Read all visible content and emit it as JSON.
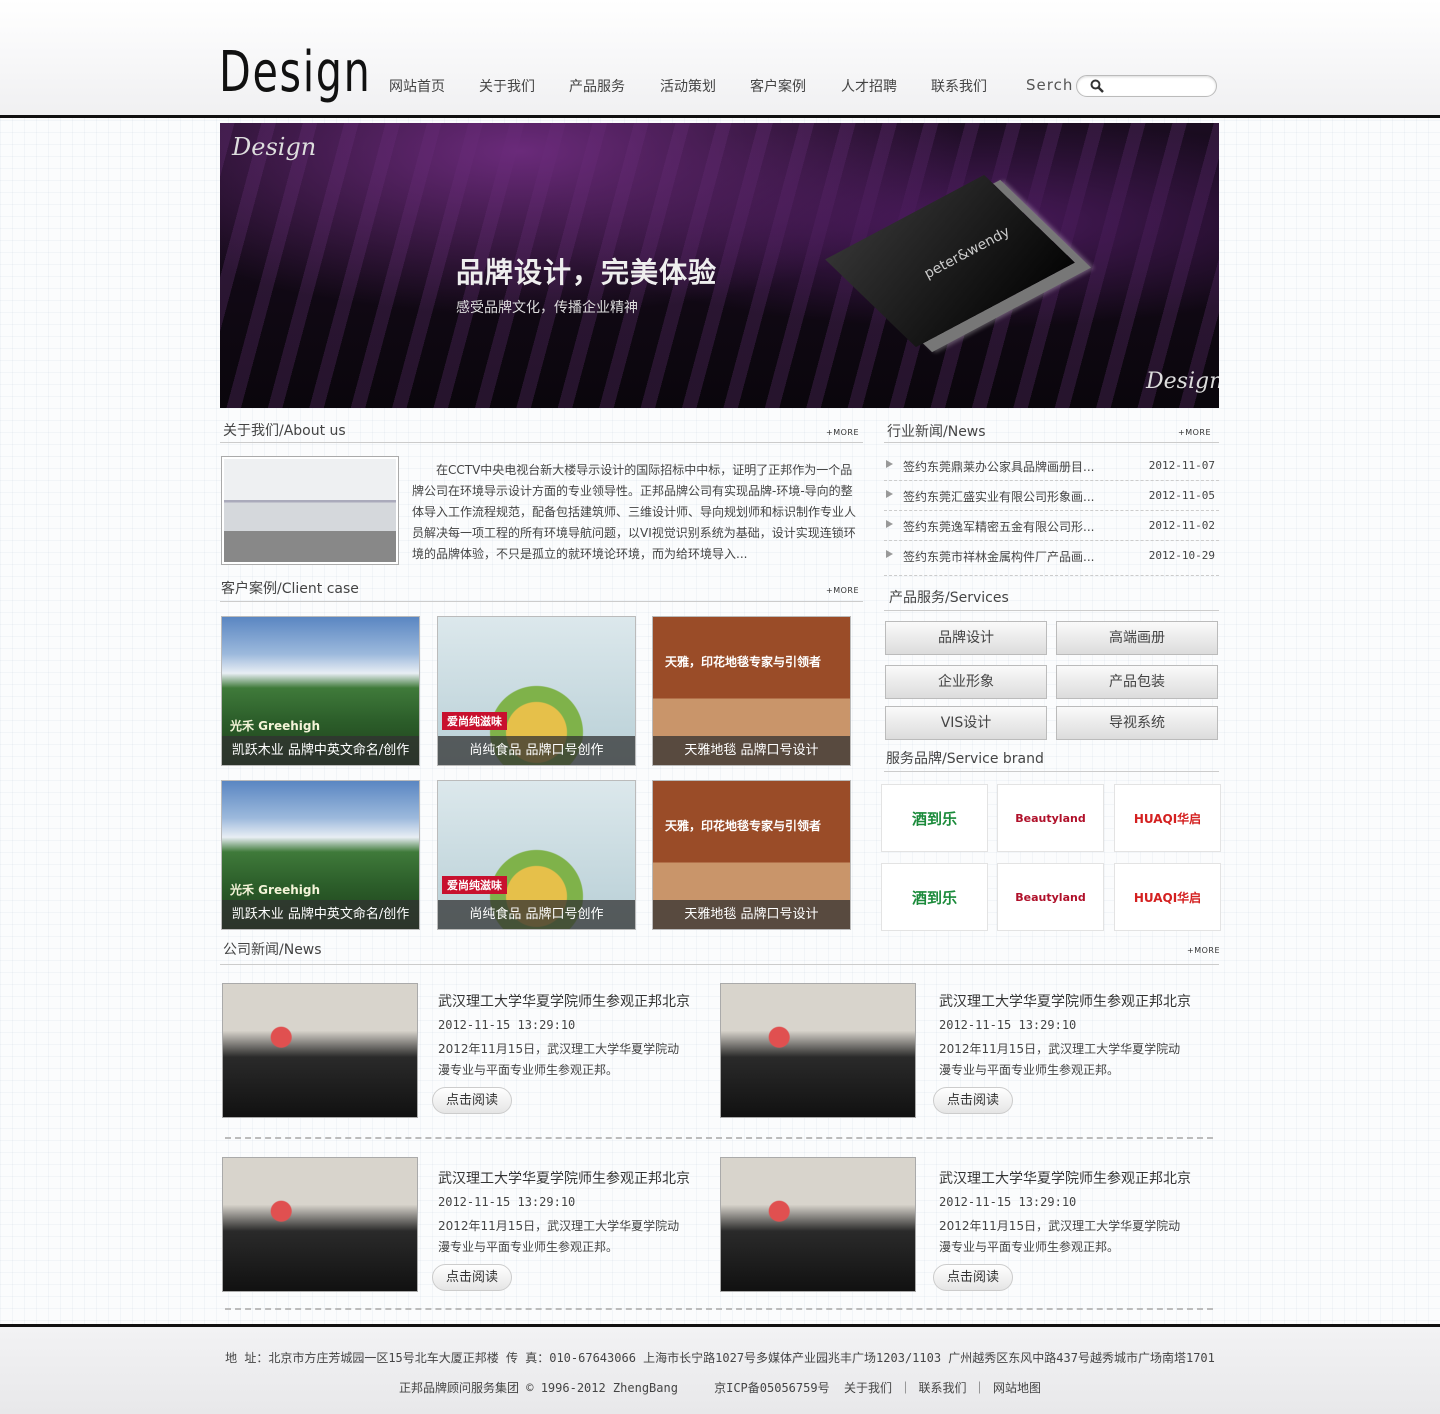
{
  "header": {
    "logo": "Design",
    "nav": [
      "网站首页",
      "关于我们",
      "产品服务",
      "活动策划",
      "客户案例",
      "人才招聘",
      "联系我们"
    ],
    "search_label": "Serch",
    "search_placeholder": ""
  },
  "banner": {
    "title": "品牌设计，完美体验",
    "subtitle": "感受品牌文化，传播企业精神",
    "script_mark": "Design",
    "card_brand": "peter&wendy"
  },
  "about": {
    "title": "关于我们/About us",
    "more": "+MORE",
    "text": "在CCTV中央电视台新大楼导示设计的国际招标中中标，证明了正邦作为一个品牌公司在环境导示设计方面的专业领导性。正邦品牌公司有实现品牌-环境-导向的整体导入工作流程规范，配备包括建筑师、三维设计师、导向规划师和标识制作专业人员解决每一项工程的所有环境导航问题，以VI视觉识别系统为基础，设计实现连锁环境的品牌体验，不只是孤立的就环境论环境，而为给环境导入..."
  },
  "industry_news": {
    "title": "行业新闻/News",
    "more": "+MORE",
    "items": [
      {
        "title": "签约东莞鼎莱办公家具品牌画册目...",
        "date": "2012-11-07"
      },
      {
        "title": "签约东莞汇盛实业有限公司形象画...",
        "date": "2012-11-05"
      },
      {
        "title": "签约东莞逸军精密五金有限公司形...",
        "date": "2012-11-02"
      },
      {
        "title": "签约东莞市祥林金属构件厂产品画...",
        "date": "2012-10-29"
      }
    ]
  },
  "cases": {
    "title": "客户案例/Client case",
    "more": "+MORE",
    "items": [
      {
        "caption": "凯跃木业 品牌中英文命名/创作",
        "tag": "光禾  Greehigh"
      },
      {
        "caption": "尚纯食品 品牌口号创作",
        "tag": "爱尚纯滋味"
      },
      {
        "caption": "天雅地毯 品牌口号设计",
        "tag": "天雅，印花地毯专家与引领者"
      },
      {
        "caption": "凯跃木业 品牌中英文命名/创作",
        "tag": "光禾  Greehigh"
      },
      {
        "caption": "尚纯食品 品牌口号创作",
        "tag": "爱尚纯滋味"
      },
      {
        "caption": "天雅地毯 品牌口号设计",
        "tag": "天雅，印花地毯专家与引领者"
      }
    ]
  },
  "services": {
    "title": "产品服务/Services",
    "items": [
      "品牌设计",
      "高端画册",
      "企业形象",
      "产品包装",
      "VIS设计",
      "导视系统"
    ]
  },
  "brands": {
    "title": "服务品牌/Service brand",
    "items": [
      "酒到乐",
      "Beautyland",
      "HUAQI华启",
      "酒到乐",
      "Beautyland",
      "HUAQI华启"
    ]
  },
  "company_news": {
    "title": "公司新闻/News",
    "more": "+MORE",
    "items": [
      {
        "title": "武汉理工大学华夏学院师生参观正邦北京",
        "date": "2012-11-15 13:29:10",
        "desc": "2012年11月15日，武汉理工大学华夏学院动漫专业与平面专业师生参观正邦。",
        "button": "点击阅读"
      },
      {
        "title": "武汉理工大学华夏学院师生参观正邦北京",
        "date": "2012-11-15 13:29:10",
        "desc": "2012年11月15日，武汉理工大学华夏学院动漫专业与平面专业师生参观正邦。",
        "button": "点击阅读"
      },
      {
        "title": "武汉理工大学华夏学院师生参观正邦北京",
        "date": "2012-11-15 13:29:10",
        "desc": "2012年11月15日，武汉理工大学华夏学院动漫专业与平面专业师生参观正邦。",
        "button": "点击阅读"
      },
      {
        "title": "武汉理工大学华夏学院师生参观正邦北京",
        "date": "2012-11-15 13:29:10",
        "desc": "2012年11月15日，武汉理工大学华夏学院动漫专业与平面专业师生参观正邦。",
        "button": "点击阅读"
      }
    ]
  },
  "footer": {
    "line1": "地 址：北京市方庄芳城园一区15号北车大厦正邦楼  传 真：010-67643066  上海市长宁路1027号多媒体产业园兆丰广场1203/1103  广州越秀区东风中路437号越秀城市广场南塔1701",
    "copyright": "正邦品牌顾问服务集团 © 1996-2012 ZhengBang",
    "icp": "京ICP备05056759号",
    "links": [
      "关于我们",
      "联系我们",
      "网站地图"
    ]
  },
  "colors": {
    "accent": "#111111",
    "banner": "#1a0c20",
    "case_caption": "#323232"
  }
}
